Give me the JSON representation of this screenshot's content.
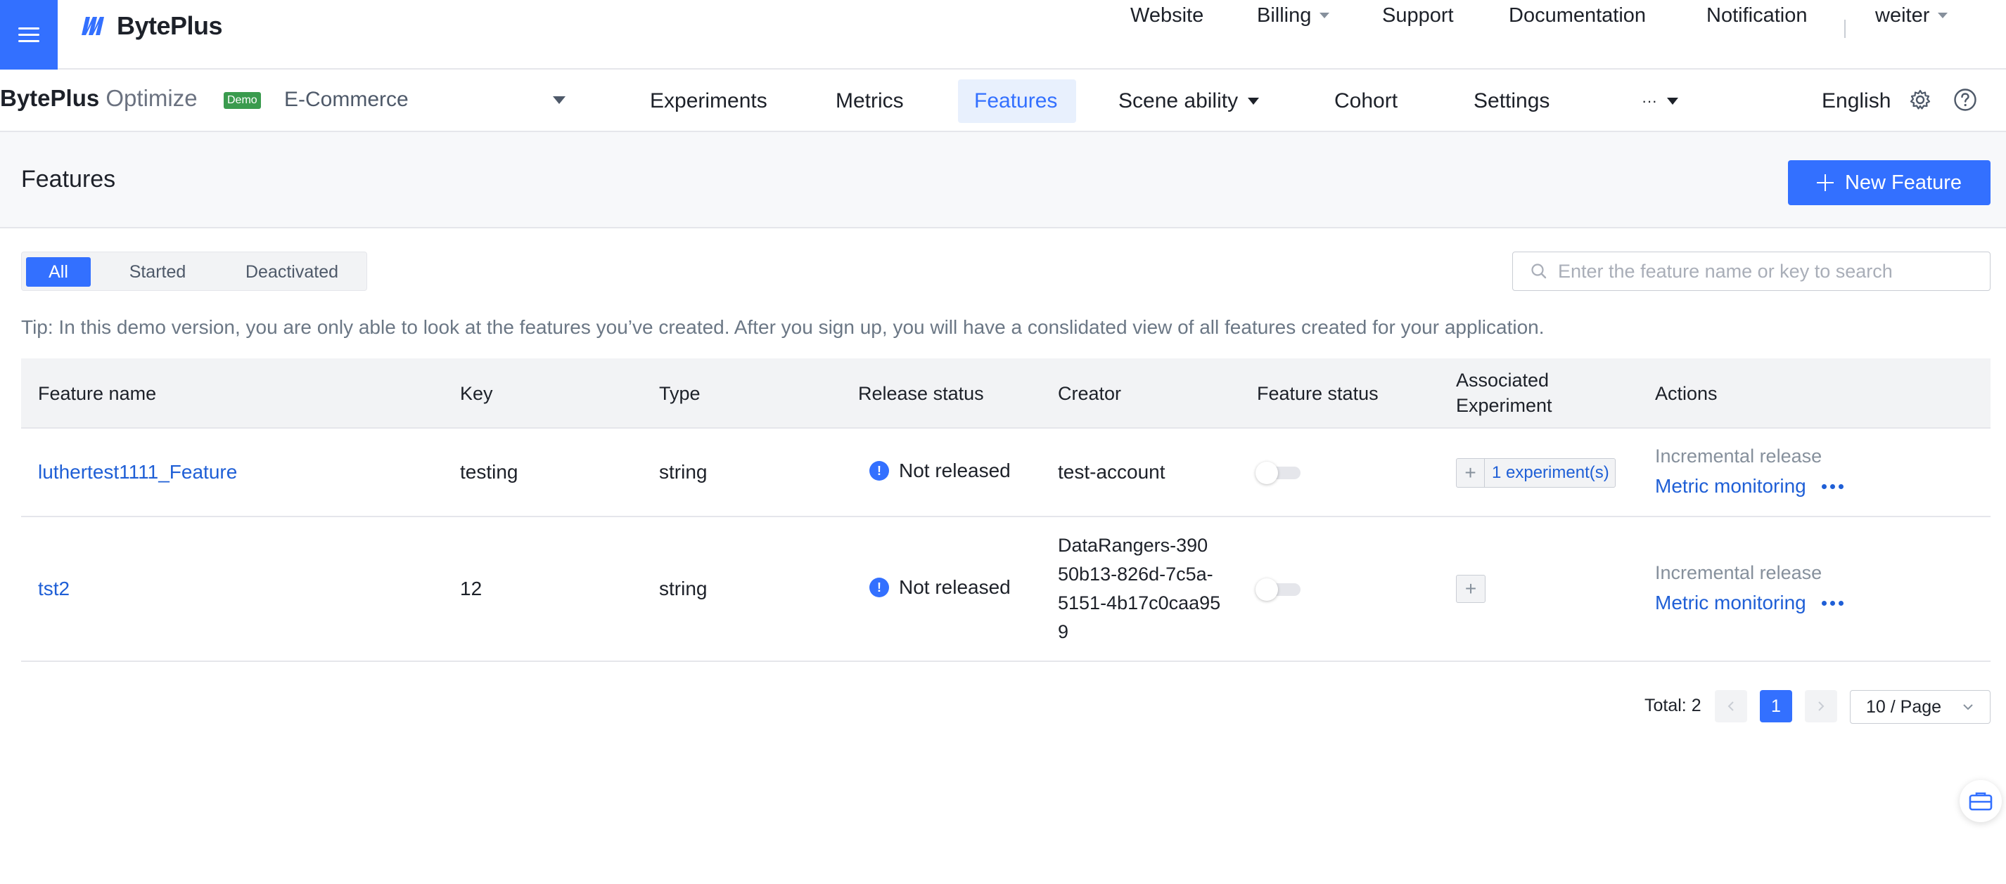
{
  "header": {
    "menu_icon": "hamburger-icon",
    "brand": "BytePlus",
    "nav": [
      {
        "label": "Website"
      },
      {
        "label": "Billing"
      },
      {
        "label": "Support"
      },
      {
        "label": "Documentation"
      },
      {
        "label": "Notification"
      },
      {
        "label": "weiter"
      }
    ]
  },
  "subheader": {
    "product_bold": "BytePlus",
    "product_light": "Optimize",
    "badge": "Demo",
    "app": "E-Commerce",
    "tabs": [
      {
        "label": "Experiments"
      },
      {
        "label": "Metrics"
      },
      {
        "label": "Features"
      },
      {
        "label": "Scene ability"
      },
      {
        "label": "Cohort"
      },
      {
        "label": "Settings"
      },
      {
        "label": "···"
      }
    ],
    "active_tab": "Features",
    "language": "English"
  },
  "page": {
    "title": "Features",
    "new_button": "New Feature"
  },
  "filters": {
    "options": [
      "All",
      "Started",
      "Deactivated"
    ],
    "selected": "All",
    "search_placeholder": "Enter the feature name or key to search"
  },
  "tip": "Tip: In this demo version, you are only able to look at the features you’ve created. After you sign up, you will have a conslidated view of all features created for your application.",
  "table": {
    "columns": [
      "Feature name",
      "Key",
      "Type",
      "Release status",
      "Creator",
      "Feature status",
      "Associated Experiment",
      "Actions"
    ],
    "rows": [
      {
        "name": "luthertest1111_Feature",
        "key": "testing",
        "type": "string",
        "release_status": "Not released",
        "creator": "test-account",
        "feature_status_on": false,
        "experiment": "1 experiment(s)",
        "action_primary": "Incremental release",
        "action_link": "Metric monitoring"
      },
      {
        "name": "tst2",
        "key": "12",
        "type": "string",
        "release_status": "Not released",
        "creator": "DataRangers-390\n50b13-826d-7c5a-\n5151-4b17c0caa95\n9",
        "feature_status_on": false,
        "experiment": "",
        "action_primary": "Incremental release",
        "action_link": "Metric monitoring"
      }
    ]
  },
  "pagination": {
    "total": "Total: 2",
    "current_page": "1",
    "page_size": "10 / Page"
  },
  "colors": {
    "primary": "#3370ff",
    "link": "#1f5fd6",
    "demo_badge": "#3a9b4e"
  }
}
